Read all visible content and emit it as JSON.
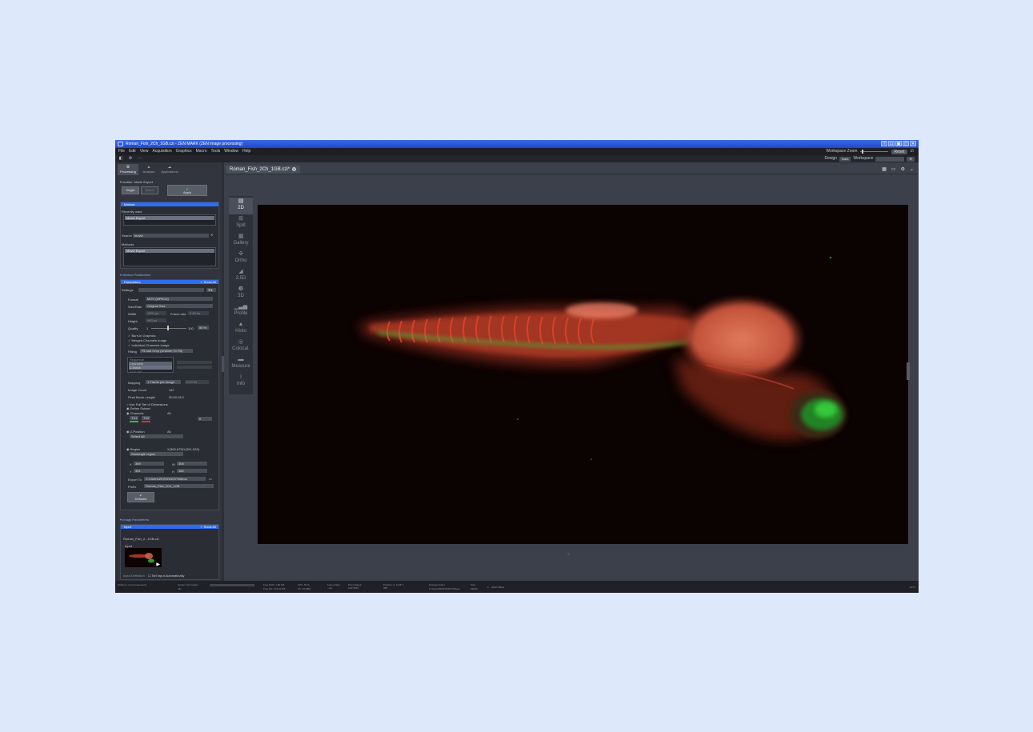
{
  "window": {
    "title": "Roman_Fish_2Ch_1GB.czi - ZEN MARK (ZEN image processing)",
    "controls": [
      "?",
      "▭",
      "▣",
      "▢",
      "✕"
    ]
  },
  "menu": {
    "items": [
      "File",
      "Edit",
      "View",
      "Acquisition",
      "Graphics",
      "Macro",
      "Tools",
      "Window",
      "Help"
    ],
    "workspace_zoom_label": "Workspace Zoom",
    "reset_label": "Reset"
  },
  "toolbar": {
    "icons": [
      "◧",
      "⚙",
      "⋯"
    ],
    "design_label": "Design",
    "design_value": "Dark",
    "workspace_label": "Workspace"
  },
  "left": {
    "tabs": [
      {
        "label": "Processing",
        "icon": "⚙"
      },
      {
        "label": "Analysis",
        "icon": "▲"
      },
      {
        "label": "Applications",
        "icon": "☁"
      }
    ],
    "function_label": "Function: Movie Export",
    "single_label": "Single",
    "batch_label": "Batch",
    "apply_label": "Apply",
    "method_title": "Method",
    "recently_used_label": "Recently used",
    "recent_item": "Movie Export",
    "search_label": "Search",
    "search_value": "movie",
    "methods_label": "Methods",
    "method_item": "Movie Export",
    "method_params_title": "Method Parameters",
    "parameters_title": "Parameters",
    "show_all_label": "✓ Show All",
    "settings_label": "Settings",
    "format_label": "Format",
    "format_value": "MOV (MPEG4)",
    "size_rate_label": "Size/Rate",
    "size_rate_value": "Original Size",
    "width_label": "Width",
    "width_value": "1902 px",
    "frame_rate_label": "Frame rate",
    "frame_rate_value": "5.00 f/s",
    "height_label": "Height",
    "height_value": "983 px",
    "quality_label": "Quality",
    "quality_min": "1",
    "quality_max": "100",
    "quality_value": "50 %",
    "burn_in_label": "✓ Burn-in Graphics",
    "merged_label": "✓ Merged Channels Image",
    "individual_label": "✓ Individual Channels Image",
    "fitting_label": "Fitting",
    "fitting_value": "Fit and Crop (Uniform To Fill)",
    "sequence_header": "Sequence",
    "sequence_items": [
      "Channels",
      "Z-Stack",
      "XYZ TxF"
    ],
    "mapping_label": "Mapping",
    "mapping_value": "1 Frame per Image",
    "mapping_extra": "5.00 f/s",
    "image_count_label": "Image Count",
    "image_count_value": "187",
    "movie_length_label": "Final Movie Length",
    "movie_length_value": "00:00:18.2",
    "full_dims_label": "Use Full Set of Dimensions",
    "define_subset_label": "Define Subset",
    "channels_label": "Channels",
    "channels_value": "All",
    "ch1": "TV1",
    "ch2": "TV2",
    "zpos_label": "Z-Position",
    "zpos_value": "All",
    "select_all": "Select All",
    "region_label": "Region",
    "region_value": "X(369-675)Y(351-533)",
    "region_type": "Rectangle region",
    "x_label": "X",
    "x_value": "369",
    "w_label": "W",
    "w_value": "306",
    "y_label": "Y",
    "y_value": "351",
    "h_label": "H",
    "h_value": "182",
    "export_to_label": "Export To",
    "export_to_value": "C:\\Users\\ZEISS\\MOV\\Videos",
    "prefix_label": "Prefix",
    "prefix_value": "Roman_Fish_2Ch_1GB",
    "defaults_label": "Defaults",
    "image_params_title": "Image Parameters",
    "input_title": "Input",
    "input_file": "Roman_Fish_2...1GB.czi",
    "input_label": "Input",
    "input_def_label": "Input Definition",
    "set_input_auto": "Set Input Automatically"
  },
  "document": {
    "tab_title": "Roman_Fish_2Ch_1GB.czi*"
  },
  "views": [
    {
      "label": "2D",
      "icon": "▤",
      "active": true
    },
    {
      "label": "Split",
      "icon": "⊞",
      "active": false
    },
    {
      "label": "Gallery",
      "icon": "▦",
      "active": false
    },
    {
      "label": "Ortho",
      "icon": "✣",
      "active": false
    },
    {
      "label": "2.5D",
      "icon": "◢",
      "active": false
    },
    {
      "label": "3D",
      "icon": "❸",
      "active": false
    },
    {
      "label": "Profile",
      "icon": "▁▃▅",
      "active": false
    },
    {
      "label": "Histo",
      "icon": "▲",
      "active": false
    },
    {
      "label": "Colocal.",
      "icon": "◎",
      "active": false
    },
    {
      "label": "Measure",
      "icon": "▬",
      "active": false
    },
    {
      "label": "Info",
      "icon": "i",
      "active": false
    }
  ],
  "status": {
    "scaling_label": "Scaling",
    "scaling_value": "1 pixel (measured)",
    "system_info_label": "System Information",
    "system_info_value": "Idle",
    "free_ram": "Free RAM: 1.80 GB",
    "free_hd": "Free HD: 103.54 GB",
    "cpu": "CPU: 52 %",
    "io": "I/O: 26 MB/s",
    "frame_rate": "Frame Rate: --fps",
    "pixel_values": "Pixel Values: 110/ 3645",
    "position": "Position: X: 1128 Y: 388",
    "storage_label": "Storage Folder",
    "storage_value": "C:\\Users\\ZEISS\\MOV\\Videos",
    "user_label": "User",
    "user_value": "ZEISS",
    "server_label": "HSM Offline",
    "time": "16:57"
  }
}
